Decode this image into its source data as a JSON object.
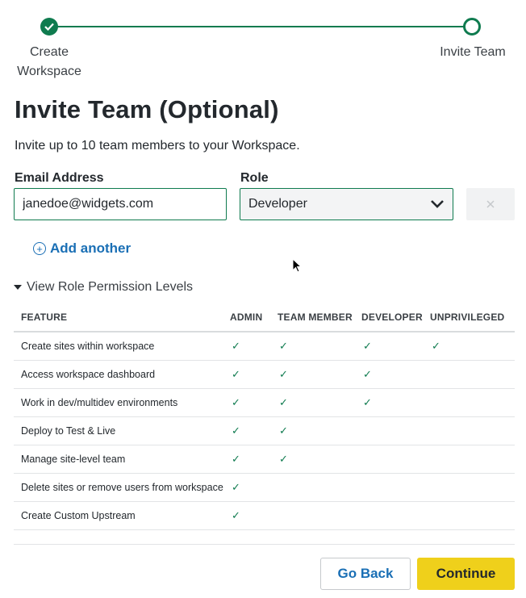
{
  "stepper": {
    "steps": [
      {
        "label": "Create Workspace",
        "state": "complete"
      },
      {
        "label": "Invite Team",
        "state": "current"
      }
    ],
    "accent": "#0f7b4f"
  },
  "title": "Invite Team (Optional)",
  "intro": "Invite up to 10 team members to your Workspace.",
  "form": {
    "email_label": "Email Address",
    "email_value": "janedoe@widgets.com",
    "role_label": "Role",
    "role_value": "Developer",
    "remove_icon": "close-icon",
    "add_another": "Add another"
  },
  "permissions": {
    "toggle_label": "View Role Permission Levels",
    "headers": [
      "FEATURE",
      "ADMIN",
      "TEAM MEMBER",
      "DEVELOPER",
      "UNPRIVILEGED"
    ],
    "check_glyph": "✓",
    "rows": [
      {
        "feature": "Create sites within workspace",
        "checks": [
          true,
          true,
          true,
          true
        ]
      },
      {
        "feature": "Access workspace dashboard",
        "checks": [
          true,
          true,
          true,
          false
        ]
      },
      {
        "feature": "Work in dev/multidev environments",
        "checks": [
          true,
          true,
          true,
          false
        ]
      },
      {
        "feature": "Deploy to Test & Live",
        "checks": [
          true,
          true,
          false,
          false
        ]
      },
      {
        "feature": "Manage site-level team",
        "checks": [
          true,
          true,
          false,
          false
        ]
      },
      {
        "feature": "Delete sites or remove users from workspace",
        "checks": [
          true,
          false,
          false,
          false
        ]
      },
      {
        "feature": "Create Custom Upstream",
        "checks": [
          true,
          false,
          false,
          false
        ]
      }
    ]
  },
  "actions": {
    "back_label": "Go Back",
    "continue_label": "Continue",
    "continue_color": "#efd01b",
    "link_color": "#1a6fb5"
  }
}
